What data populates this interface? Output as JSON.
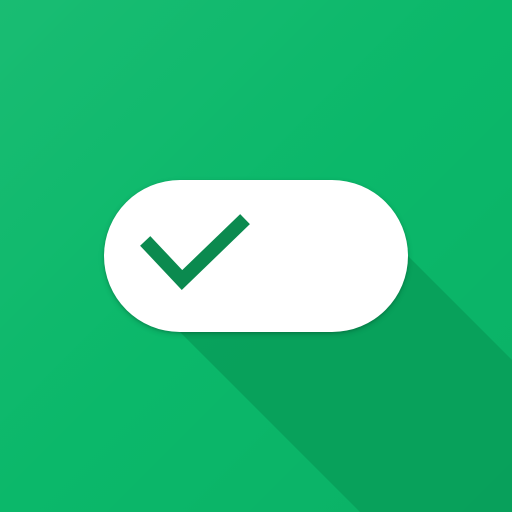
{
  "app_icon": {
    "icon_name": "toggle-check-icon",
    "colors": {
      "background": "#0BB86A",
      "pill": "#FFFFFF",
      "check": "#0B8A4F",
      "long_shadow": "#089D59"
    }
  }
}
